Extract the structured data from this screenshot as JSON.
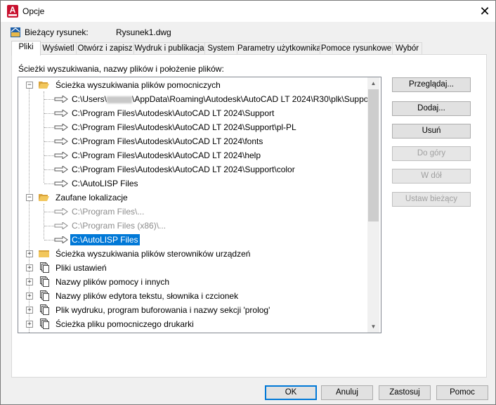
{
  "window": {
    "title": "Opcje"
  },
  "drawing": {
    "label": "Bieżący rysunek:",
    "name": "Rysunek1.dwg"
  },
  "tabs": [
    "Pliki",
    "Wyświetl",
    "Otwórz i zapisz",
    "Wydruk i publikacja",
    "System",
    "Parametry użytkownika",
    "Pomoce rysunkowe",
    "Wybór"
  ],
  "active_tab": "Pliki",
  "section_label": "Ścieżki wyszukiwania, nazwy plików i położenie plików:",
  "tree": {
    "support_path": {
      "label": "Ścieżka wyszukiwania plików pomocniczych",
      "items": [
        "C:\\Users\\",
        "\\AppData\\Roaming\\Autodesk\\AutoCAD LT 2024\\R30\\plk\\Support",
        "C:\\Program Files\\Autodesk\\AutoCAD LT 2024\\Support",
        "C:\\Program Files\\Autodesk\\AutoCAD LT 2024\\Support\\pl-PL",
        "C:\\Program Files\\Autodesk\\AutoCAD LT 2024\\fonts",
        "C:\\Program Files\\Autodesk\\AutoCAD LT 2024\\help",
        "C:\\Program Files\\Autodesk\\AutoCAD LT 2024\\Support\\color",
        "C:\\AutoLISP Files"
      ]
    },
    "trusted": {
      "label": "Zaufane lokalizacje",
      "items": [
        "C:\\Program Files\\...",
        "C:\\Program Files (x86)\\...",
        "C:\\AutoLISP Files"
      ]
    },
    "collapsed": [
      "Ścieżka wyszukiwania plików sterowników urządzeń",
      "Pliki ustawień",
      "Nazwy plików pomocy i innych",
      "Nazwy plików edytora tekstu, słownika i czcionek",
      "Plik wydruku, program buforowania i nazwy sekcji 'prolog'",
      "Ścieżka pliku pomocniczego drukarki"
    ]
  },
  "side_buttons": {
    "browse": "Przeglądaj...",
    "add": "Dodaj...",
    "remove": "Usuń",
    "move_up": "Do góry",
    "move_down": "W dół",
    "set_current": "Ustaw bieżący"
  },
  "bottom_buttons": {
    "ok": "OK",
    "cancel": "Anuluj",
    "apply": "Zastosuj",
    "help": "Pomoc"
  },
  "colors": {
    "selection": "#0078d7",
    "app_icon": "#c8102e",
    "folder": "#e8b84a"
  }
}
